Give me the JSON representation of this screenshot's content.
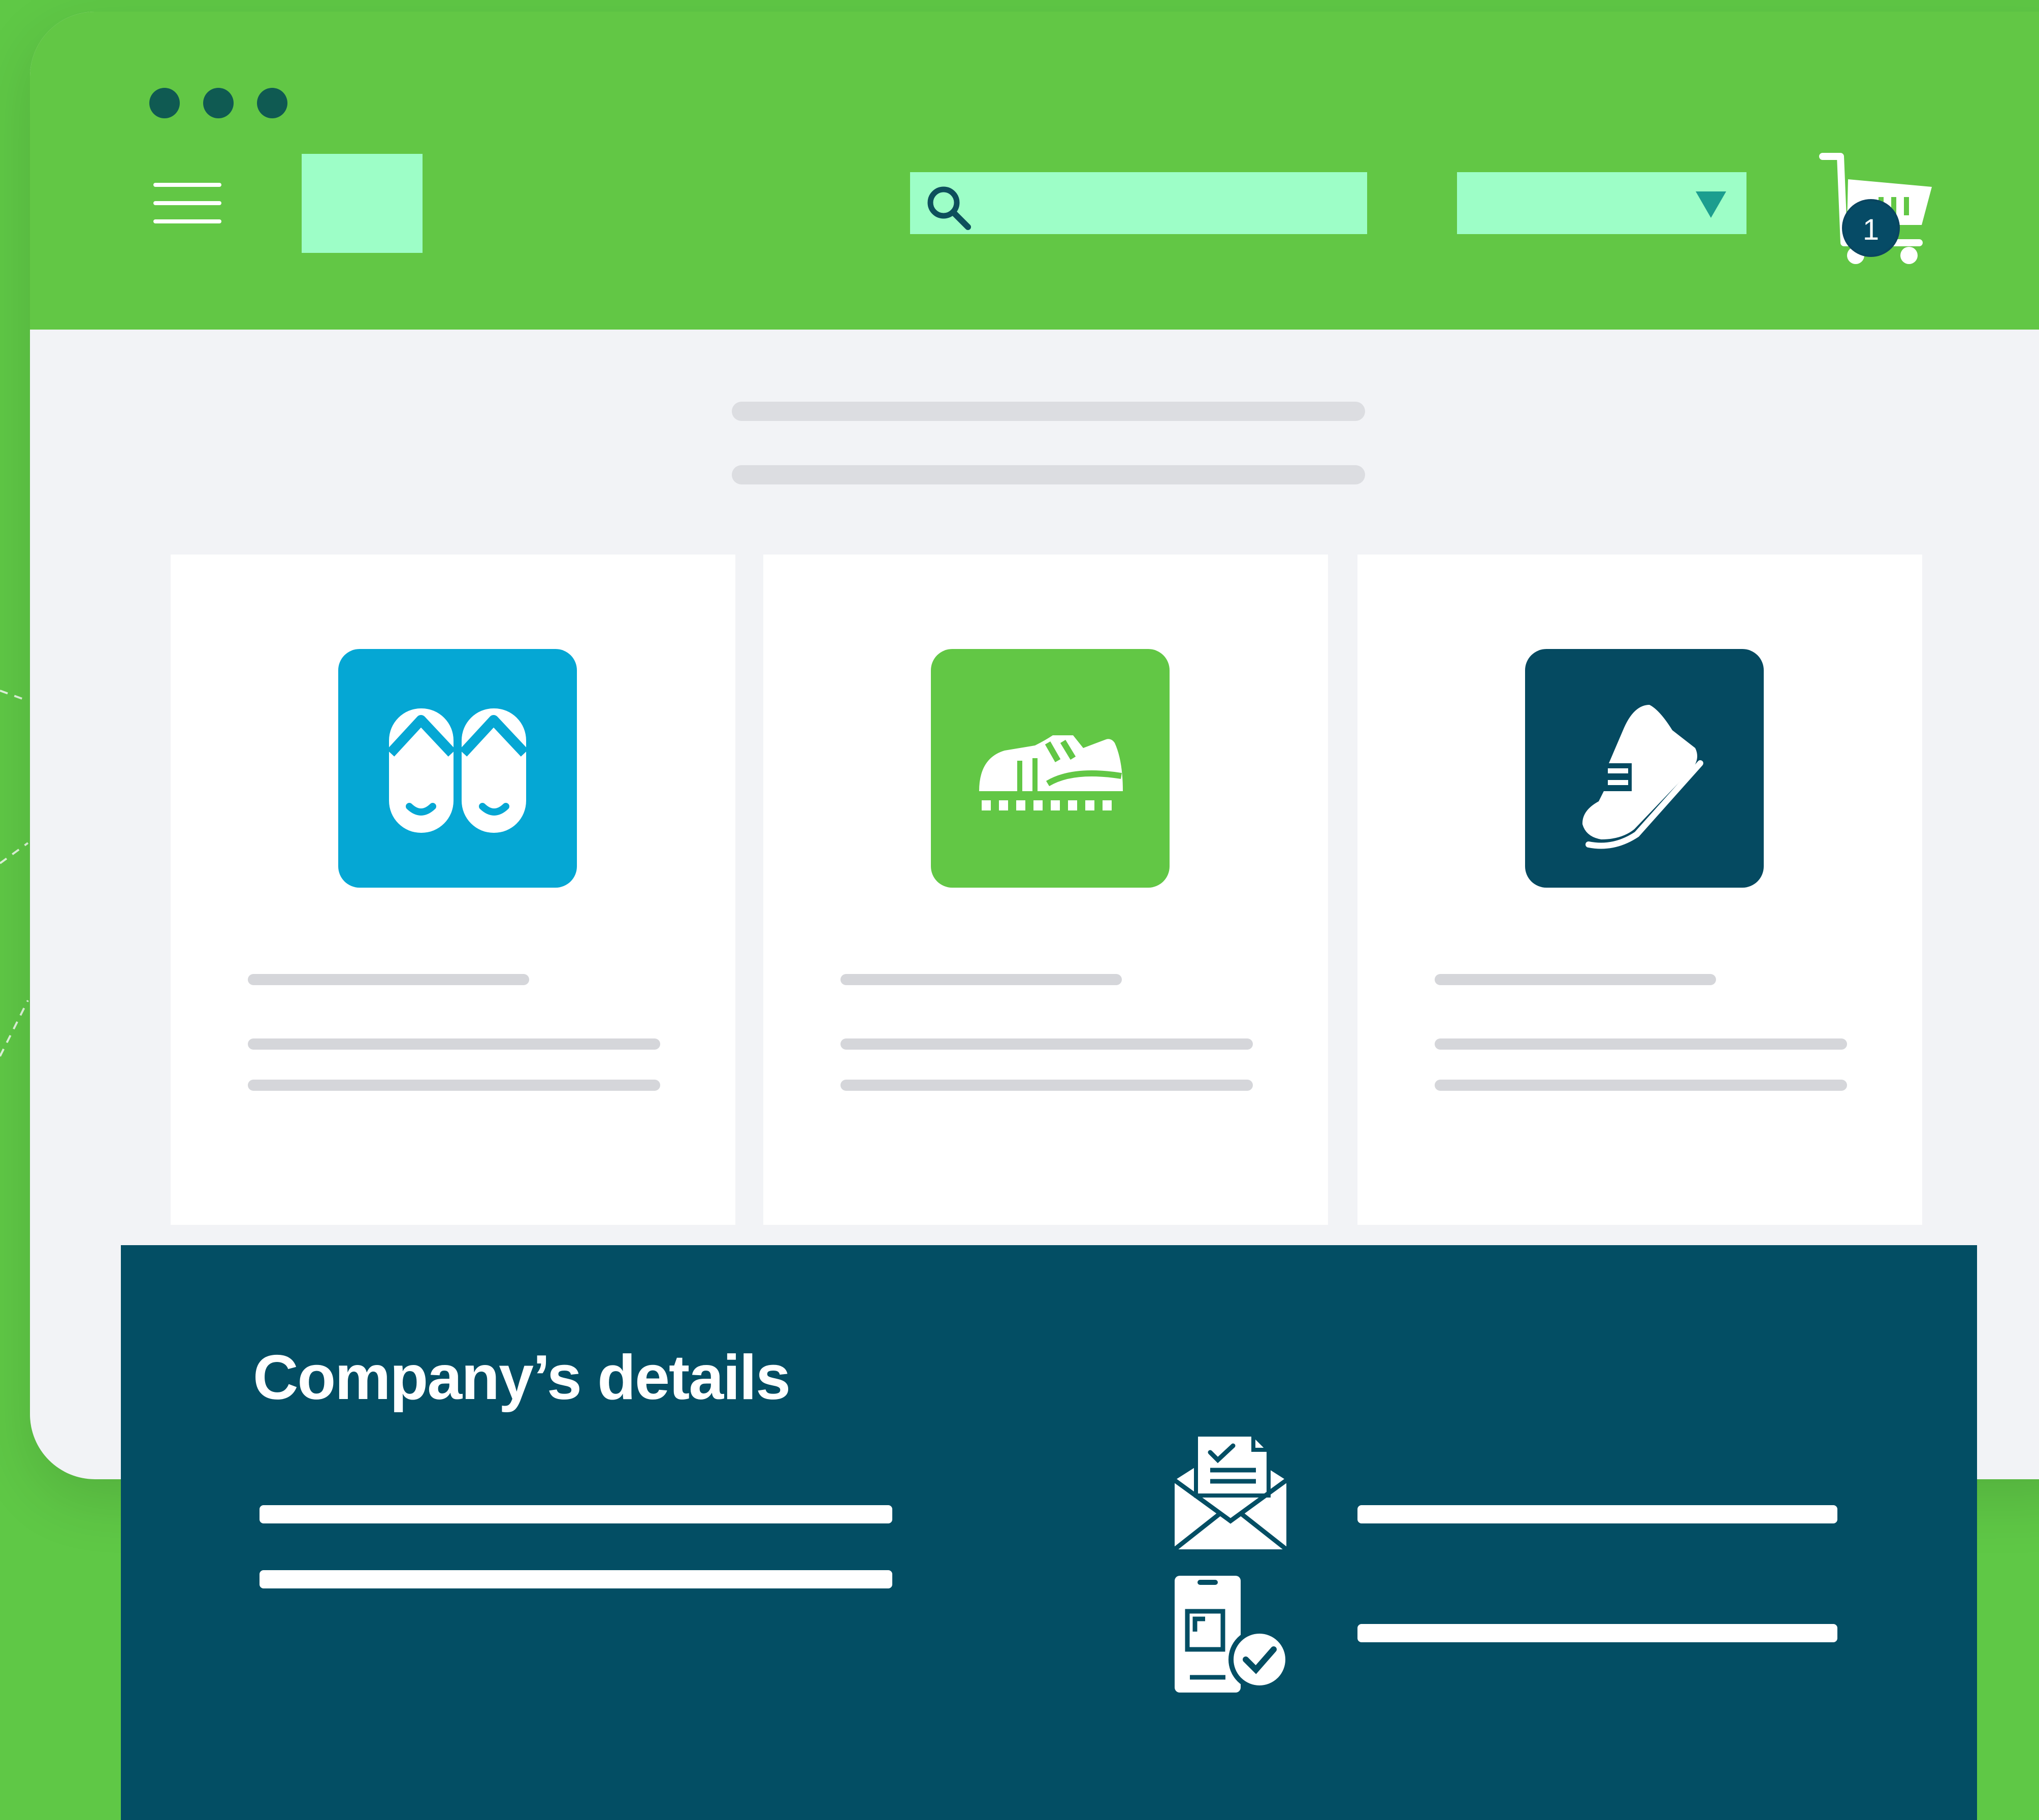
{
  "window": {
    "traffic_dots": [
      "dot",
      "dot",
      "dot"
    ]
  },
  "header": {
    "menu_icon": "hamburger-menu-icon",
    "logo": "logo-placeholder",
    "search": {
      "icon": "search-icon",
      "value": "",
      "placeholder": ""
    },
    "dropdown": {
      "selected": "",
      "icon": "chevron-down-icon"
    },
    "cart": {
      "icon": "shopping-cart-icon",
      "count": "1"
    }
  },
  "colors": {
    "brand_green": "#62c745",
    "mint": "#9dfec7",
    "navy": "#034e64",
    "blue": "#05a7d4",
    "page_bg": "#f2f3f6"
  },
  "products": [
    {
      "icon": "flip-flops-icon",
      "icon_bg": "#05a7d4"
    },
    {
      "icon": "cleats-shoe-icon",
      "icon_bg": "#62c745"
    },
    {
      "icon": "sneaker-icon",
      "icon_bg": "#054a61"
    }
  ],
  "company": {
    "title": "Company’s details",
    "icons": [
      "email-document-icon",
      "mobile-verified-icon"
    ]
  }
}
